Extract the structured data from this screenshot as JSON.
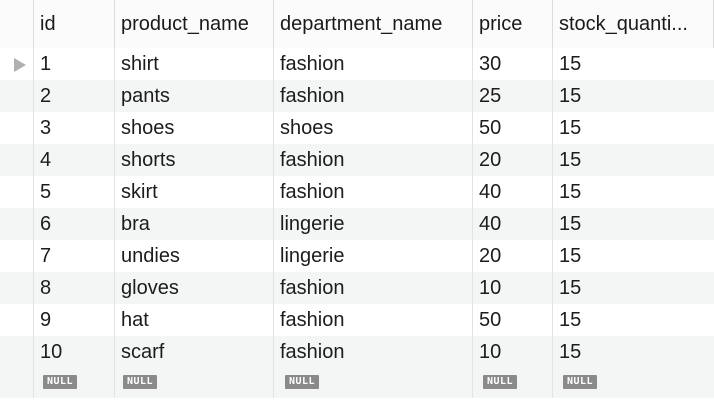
{
  "table": {
    "columns": [
      "id",
      "product_name",
      "department_name",
      "price",
      "stock_quanti..."
    ],
    "rows": [
      {
        "id": "1",
        "product_name": "shirt",
        "department_name": "fashion",
        "price": "30",
        "stock_quantity": "15"
      },
      {
        "id": "2",
        "product_name": "pants",
        "department_name": "fashion",
        "price": "25",
        "stock_quantity": "15"
      },
      {
        "id": "3",
        "product_name": "shoes",
        "department_name": "shoes",
        "price": "50",
        "stock_quantity": "15"
      },
      {
        "id": "4",
        "product_name": "shorts",
        "department_name": "fashion",
        "price": "20",
        "stock_quantity": "15"
      },
      {
        "id": "5",
        "product_name": "skirt",
        "department_name": "fashion",
        "price": "40",
        "stock_quantity": "15"
      },
      {
        "id": "6",
        "product_name": "bra",
        "department_name": "lingerie",
        "price": "40",
        "stock_quantity": "15"
      },
      {
        "id": "7",
        "product_name": "undies",
        "department_name": "lingerie",
        "price": "20",
        "stock_quantity": "15"
      },
      {
        "id": "8",
        "product_name": "gloves",
        "department_name": "fashion",
        "price": "10",
        "stock_quantity": "15"
      },
      {
        "id": "9",
        "product_name": "hat",
        "department_name": "fashion",
        "price": "50",
        "stock_quantity": "15"
      },
      {
        "id": "10",
        "product_name": "scarf",
        "department_name": "fashion",
        "price": "10",
        "stock_quantity": "15"
      }
    ],
    "new_row": {
      "id": "NULL",
      "product_name": "NULL",
      "department_name": "NULL",
      "price": "NULL",
      "stock_quantity": "NULL"
    },
    "current_row_marker_icon": "triangle-right-icon"
  }
}
